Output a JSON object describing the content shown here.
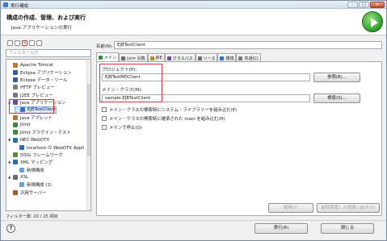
{
  "window": {
    "title": "実行構成"
  },
  "banner": {
    "heading": "構成の作成、管理、および実行",
    "subtitle": "Java アプリケーションの実行"
  },
  "left": {
    "filter_placeholder": "フィルター入力",
    "tree": [
      {
        "label": "Apache Tomcat",
        "color": "#c4762f",
        "level": 1,
        "expand": ""
      },
      {
        "label": "Eclipse アプリケーション",
        "color": "#3a5aa8",
        "level": 1,
        "expand": ""
      },
      {
        "label": "Eclipse データ・ツール",
        "color": "#3a5aa8",
        "level": 1,
        "expand": ""
      },
      {
        "label": "HTTP プレビュー",
        "color": "#7a7a7a",
        "level": 1,
        "expand": ""
      },
      {
        "label": "J2EE プレビュー",
        "color": "#7a7a7a",
        "level": 1,
        "expand": ""
      },
      {
        "label": "Java アプリケーション",
        "color": "#6a4aa8",
        "level": 1,
        "expand": "▲"
      },
      {
        "label": "EJBTestClient",
        "color": "#3a6ec8",
        "level": 2,
        "expand": "",
        "selected": true
      },
      {
        "label": "Java アプレット",
        "color": "#b07a2a",
        "level": 1,
        "expand": ""
      },
      {
        "label": "JUnit",
        "color": "#3a8a3a",
        "level": 1,
        "expand": ""
      },
      {
        "label": "JUnit プラグイン・テスト",
        "color": "#3a8a3a",
        "level": 1,
        "expand": ""
      },
      {
        "label": "NEC WebOTX",
        "color": "#2f6ab0",
        "level": 1,
        "expand": "▲"
      },
      {
        "label": "localhost の WebOTX Appli",
        "color": "#2f6ab0",
        "level": 2,
        "expand": ""
      },
      {
        "label": "OSGi フレームワーク",
        "color": "#5a8a3a",
        "level": 1,
        "expand": ""
      },
      {
        "label": "XML マッピング",
        "color": "#2f6ab0",
        "level": 1,
        "expand": "▲"
      },
      {
        "label": "新規構成",
        "color": "#6aa0d8",
        "level": 2,
        "expand": ""
      },
      {
        "label": "XSL",
        "color": "#6a6a6a",
        "level": 1,
        "expand": "▲"
      },
      {
        "label": "新規構成 (1)",
        "color": "#6aa0d8",
        "level": 2,
        "expand": ""
      },
      {
        "label": "汎用サーバー",
        "color": "#a05a2a",
        "level": 1,
        "expand": ""
      }
    ],
    "filter_status": "フィルター数: 20 / 25 項目"
  },
  "right": {
    "name_label": "名前(N):",
    "name_value": "EJBTestClient",
    "tabs": [
      {
        "label": "メイン",
        "color": "#3a8a3a",
        "active": true
      },
      {
        "label": "(x)= 引数",
        "color": "#6a6a6a",
        "active": false
      },
      {
        "label": "JRE",
        "color": "#c08a2a",
        "active": false
      },
      {
        "label": "クラスパス",
        "color": "#6a4aa8",
        "active": false
      },
      {
        "label": "ソース",
        "color": "#6a6a6a",
        "active": false
      },
      {
        "label": "環境",
        "color": "#3a6ec8",
        "active": false
      },
      {
        "label": "共通(C)",
        "color": "#7a7a7a",
        "active": false
      }
    ],
    "project_label": "プロジェクト(P):",
    "project_value": "EJBTestMDClient",
    "browse_button": "参照(B)...",
    "main_class_label": "メイン・クラス(M):",
    "main_class_value": "sample.EJBTestClient",
    "search_button": "検索(S)...",
    "checks": [
      "メイン・クラスの検索時にシステム・ライブラリーを組み込む(E)",
      "メイン・クラスの検索時に継承された main を組み込む(H)",
      "メインで停止(O)"
    ],
    "apply_button": "適用(Y)",
    "revert_button": "前回保管した状態に戻す(V)"
  },
  "footer": {
    "run_button": "実行(R)",
    "close_button": "閉じる"
  }
}
